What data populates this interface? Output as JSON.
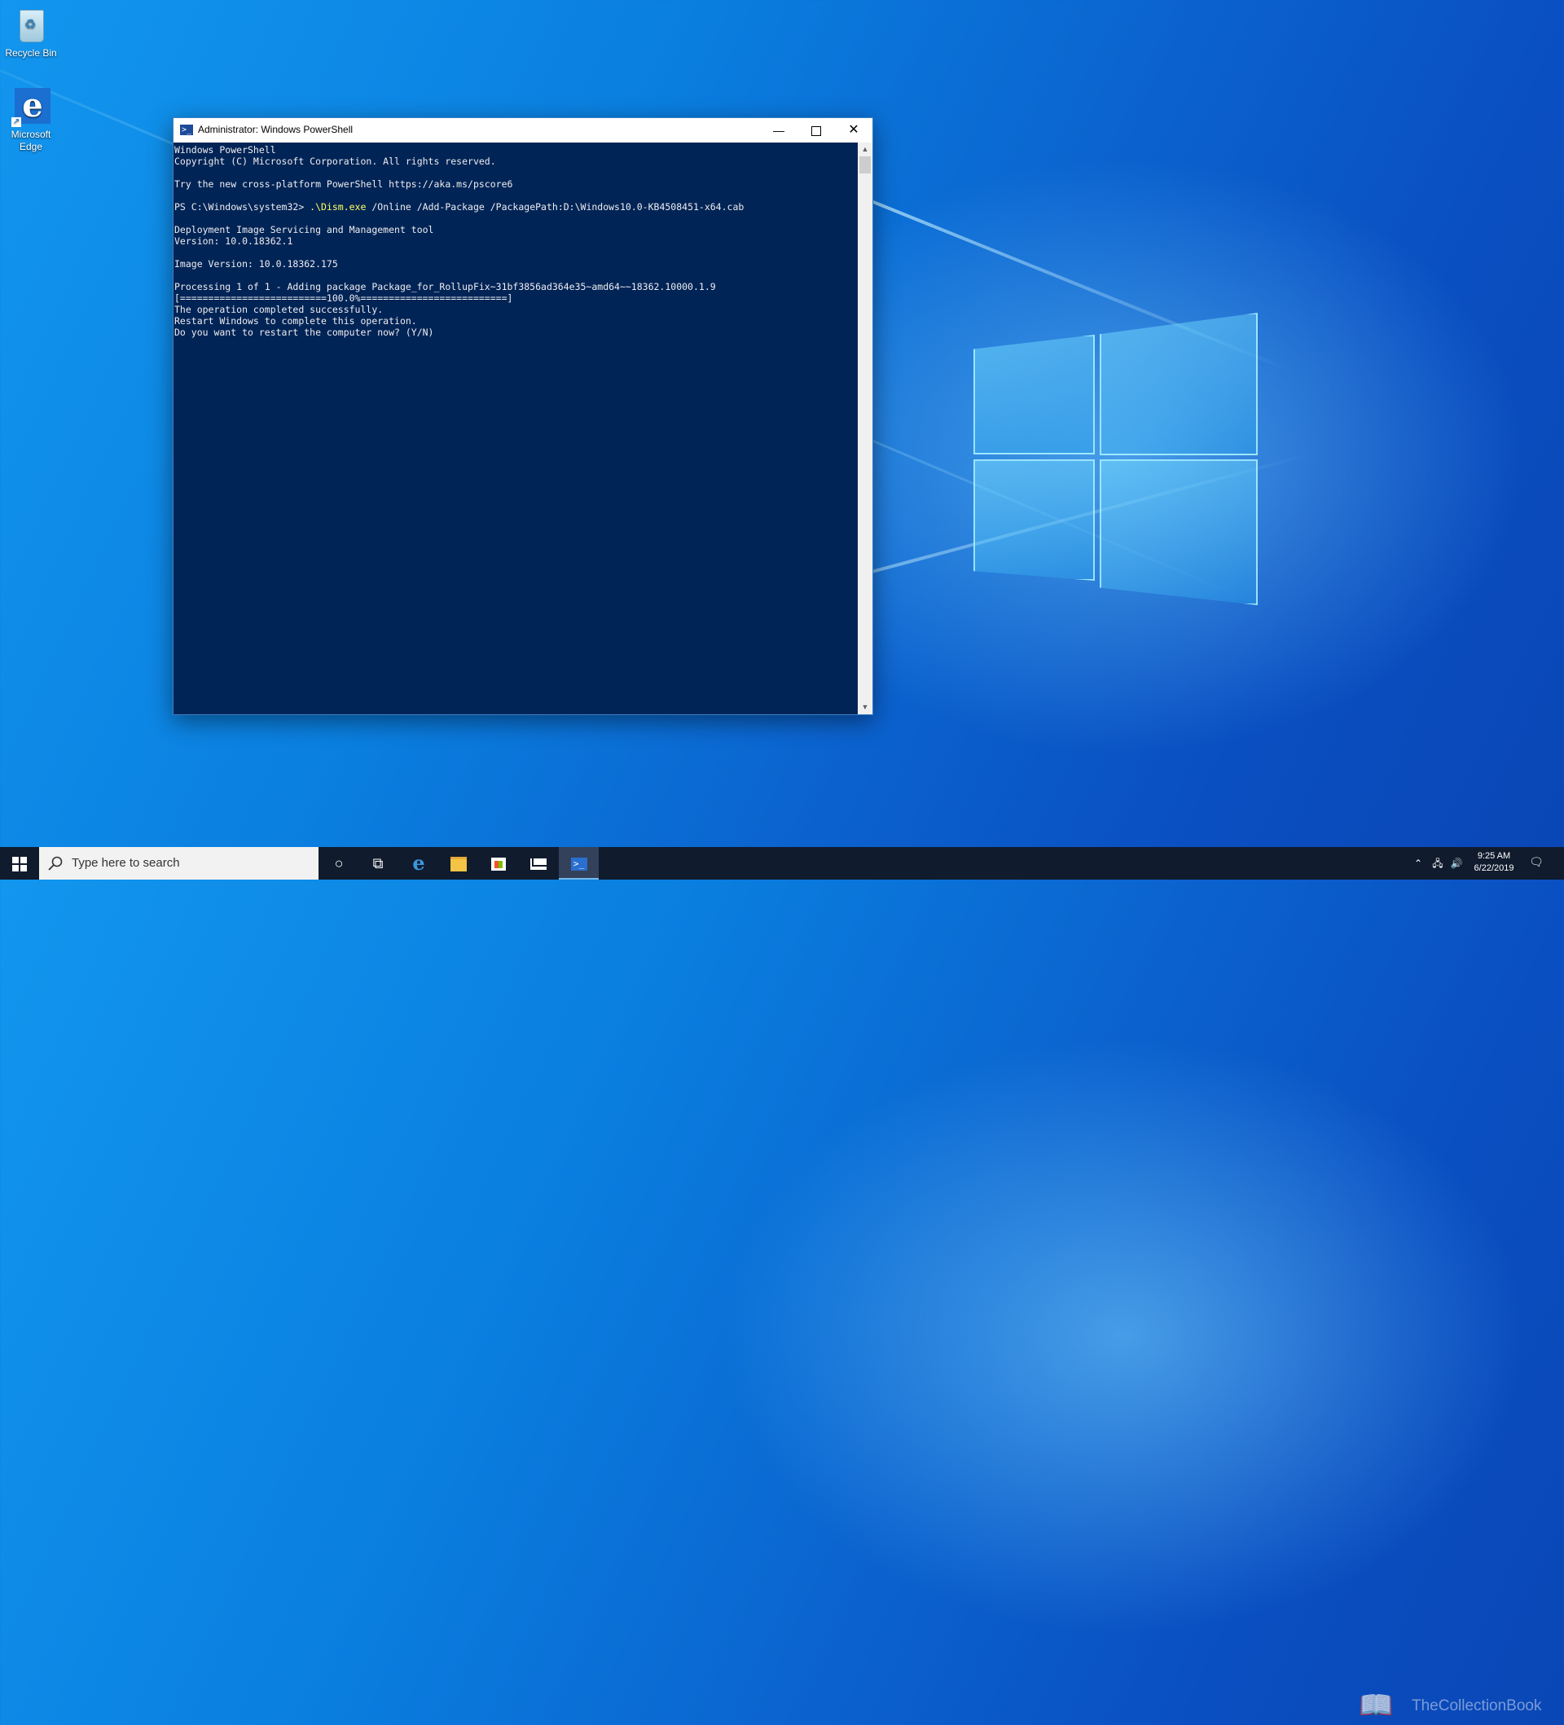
{
  "desktop": {
    "icons": [
      {
        "label": "Recycle Bin"
      },
      {
        "label": "Microsoft Edge",
        "line1": "Microsoft",
        "line2": "Edge"
      }
    ],
    "wallpaper_color": "#0a7fe0"
  },
  "window": {
    "title": "Administrator: Windows PowerShell",
    "controls": {
      "minimize": "—",
      "close": "✕"
    },
    "console_background": "#012456",
    "console_foreground": "#eeedf0",
    "command_color": "#ffff5f",
    "console": {
      "line1": "Windows PowerShell",
      "line2": "Copyright (C) Microsoft Corporation. All rights reserved.",
      "line3": "",
      "line4": "Try the new cross-platform PowerShell https://aka.ms/pscore6",
      "line5": "",
      "prompt": "PS C:\\Windows\\system32> ",
      "command": ".\\Dism.exe",
      "command_args": " /Online /Add-Package /PackagePath:D:\\Windows10.0-KB4508451-x64.cab",
      "line7": "",
      "line8": "Deployment Image Servicing and Management tool",
      "line9": "Version: 10.0.18362.1",
      "line10": "",
      "line11": "Image Version: 10.0.18362.175",
      "line12": "",
      "line13": "Processing 1 of 1 - Adding package Package_for_RollupFix~31bf3856ad364e35~amd64~~18362.10000.1.9",
      "line14": "[==========================100.0%==========================]",
      "line15": "The operation completed successfully.",
      "line16": "Restart Windows to complete this operation.",
      "line17": "Do you want to restart the computer now? (Y/N)"
    }
  },
  "taskbar": {
    "search_placeholder": "Type here to search",
    "apps": [
      "start-icon",
      "cortana-icon",
      "task-view-icon",
      "edge-icon",
      "file-explorer-icon",
      "store-icon",
      "mail-icon",
      "powershell-icon"
    ],
    "active_app": "powershell-icon",
    "tray": {
      "time": "9:25 AM",
      "date": "6/22/2019"
    }
  },
  "watermark": {
    "text": "TheCollectionBook"
  }
}
